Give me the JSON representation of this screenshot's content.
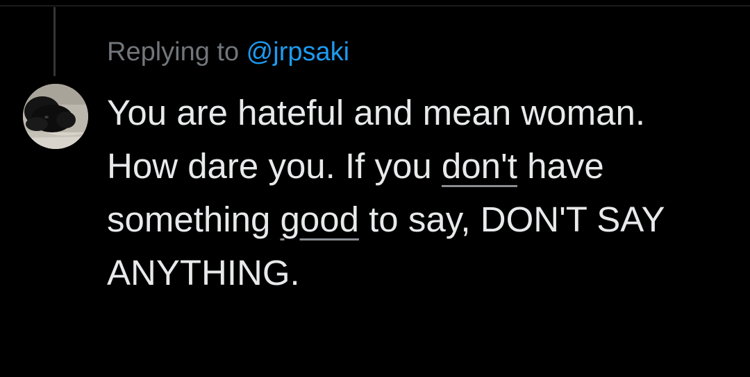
{
  "reply_context": {
    "prefix": "Replying to ",
    "mention": "@jrpsaki"
  },
  "tweet": {
    "line1": "You are hateful and mean woman.",
    "line2": {
      "before": "How dare you. If you ",
      "word": "don't",
      "after": " have"
    },
    "line3": {
      "before": "something ",
      "word": "good",
      "after": " to say, DON'T SAY"
    },
    "line4": "ANYTHING."
  },
  "colors": {
    "background": "#000000",
    "text": "#e7e9ea",
    "secondary": "#71767b",
    "mention": "#1d9bf0",
    "thread_line": "#333639"
  }
}
